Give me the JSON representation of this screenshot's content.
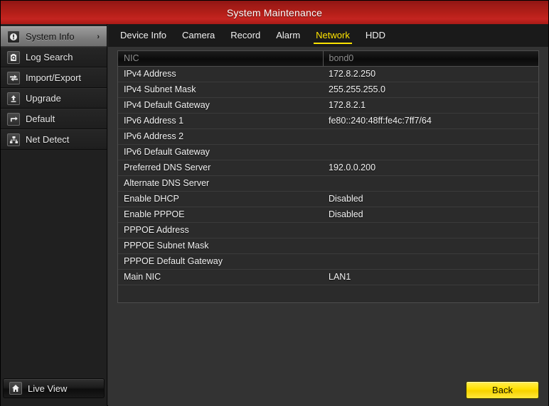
{
  "window": {
    "title": "System Maintenance"
  },
  "sidebar": {
    "items": [
      {
        "label": "System Info",
        "icon": "info-circle-icon",
        "active": true,
        "chevron": "›"
      },
      {
        "label": "Log Search",
        "icon": "log-search-icon",
        "active": false,
        "chevron": ""
      },
      {
        "label": "Import/Export",
        "icon": "import-export-icon",
        "active": false,
        "chevron": ""
      },
      {
        "label": "Upgrade",
        "icon": "upgrade-icon",
        "active": false,
        "chevron": ""
      },
      {
        "label": "Default",
        "icon": "restore-default-icon",
        "active": false,
        "chevron": ""
      },
      {
        "label": "Net Detect",
        "icon": "net-detect-icon",
        "active": false,
        "chevron": ""
      }
    ],
    "live_view": {
      "label": "Live View",
      "icon": "home-icon"
    }
  },
  "tabs": [
    {
      "label": "Device Info",
      "active": false
    },
    {
      "label": "Camera",
      "active": false
    },
    {
      "label": "Record",
      "active": false
    },
    {
      "label": "Alarm",
      "active": false
    },
    {
      "label": "Network",
      "active": true
    },
    {
      "label": "HDD",
      "active": false
    }
  ],
  "table": {
    "header": {
      "key": "NIC",
      "value": "bond0"
    },
    "rows": [
      {
        "key": "IPv4 Address",
        "value": "172.8.2.250"
      },
      {
        "key": "IPv4 Subnet Mask",
        "value": "255.255.255.0"
      },
      {
        "key": "IPv4 Default Gateway",
        "value": "172.8.2.1"
      },
      {
        "key": "IPv6 Address 1",
        "value": "fe80::240:48ff:fe4c:7ff7/64"
      },
      {
        "key": "IPv6 Address 2",
        "value": ""
      },
      {
        "key": "IPv6 Default Gateway",
        "value": ""
      },
      {
        "key": "Preferred DNS Server",
        "value": "192.0.0.200"
      },
      {
        "key": "Alternate DNS Server",
        "value": ""
      },
      {
        "key": "Enable DHCP",
        "value": "Disabled"
      },
      {
        "key": "Enable PPPOE",
        "value": "Disabled"
      },
      {
        "key": "PPPOE Address",
        "value": ""
      },
      {
        "key": "PPPOE Subnet Mask",
        "value": ""
      },
      {
        "key": "PPPOE Default Gateway",
        "value": ""
      },
      {
        "key": "Main NIC",
        "value": "LAN1"
      },
      {
        "key": "",
        "value": ""
      }
    ]
  },
  "footer": {
    "back_label": "Back"
  },
  "colors": {
    "titlebar_red": "#b51f19",
    "accent_yellow": "#ffe400",
    "panel_bg": "#333333",
    "table_bg": "#2b2b2b"
  }
}
